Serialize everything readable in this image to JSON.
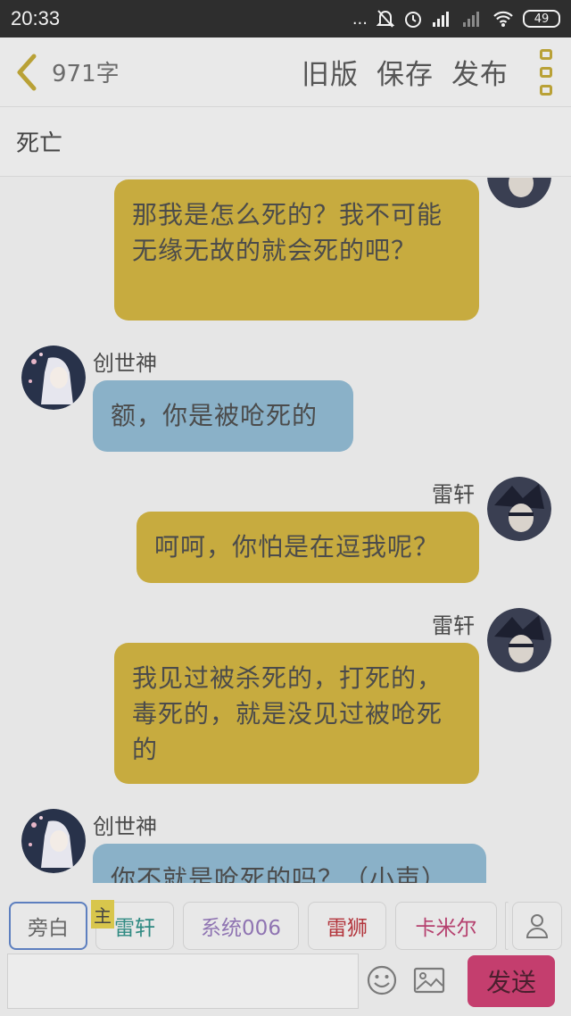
{
  "status_bar": {
    "time": "20:33",
    "battery": "49",
    "dots": "...",
    "icons": [
      "bell-off-icon",
      "alarm-icon",
      "signal-icon",
      "signal-weak-icon",
      "wifi-icon",
      "battery-icon"
    ]
  },
  "toolbar": {
    "word_count": "971字",
    "old_version": "旧版",
    "save": "保存",
    "publish": "发布"
  },
  "title": "死亡",
  "chat": {
    "names": {
      "creator_god": "创世神",
      "lei_xuan": "雷轩"
    },
    "messages": [
      {
        "speaker": "雷轩",
        "side": "right",
        "text": "那我是怎么死的？我不可能无缘无故的就会死的吧？"
      },
      {
        "speaker": "创世神",
        "side": "left",
        "text": "额，你是被呛死的"
      },
      {
        "speaker": "雷轩",
        "side": "right",
        "text": "呵呵，你怕是在逗我呢？"
      },
      {
        "speaker": "雷轩",
        "side": "right",
        "text": "我见过被杀死的，打死的，毒死的，就是没见过被呛死的"
      },
      {
        "speaker": "创世神",
        "side": "left",
        "text": "你不就是呛死的吗？（小声）"
      }
    ]
  },
  "roles": {
    "narration": "旁白",
    "main_tag": "主",
    "lei_xuan": "雷轩",
    "system": "系统006",
    "lei_shi": "雷狮",
    "camille": "卡米尔"
  },
  "input": {
    "placeholder": "",
    "send": "发送"
  },
  "colors": {
    "right_bubble": "#c7ab3f",
    "left_bubble": "#8ab1c8",
    "send_button": "#c43e6e",
    "accent": "#b9a136"
  }
}
